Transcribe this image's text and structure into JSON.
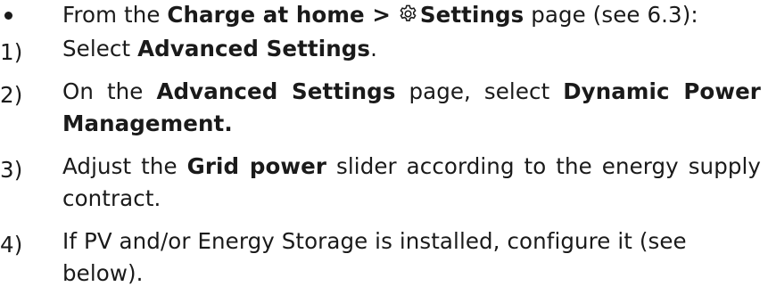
{
  "bullet": {
    "from": "From the",
    "charge_at_home": "Charge at home >",
    "gear_icon": "settings-gear-icon",
    "settings": "Settings",
    "page_ref": "page (see 6.3):"
  },
  "steps": [
    {
      "number": "1)",
      "select": "Select",
      "target": "Advanced Settings",
      "end": "."
    },
    {
      "number": "2)",
      "on_the": "On the",
      "page_name": "Advanced Settings",
      "page_select": "page, select",
      "option": "Dynamic Power Management."
    },
    {
      "number": "3)",
      "adjust": "Adjust the",
      "slider_name": "Grid power",
      "rest": "slider according to the energy supply contract."
    },
    {
      "number": "4)",
      "text": "If PV and/or Energy Storage is installed, configure it (see below)."
    }
  ]
}
